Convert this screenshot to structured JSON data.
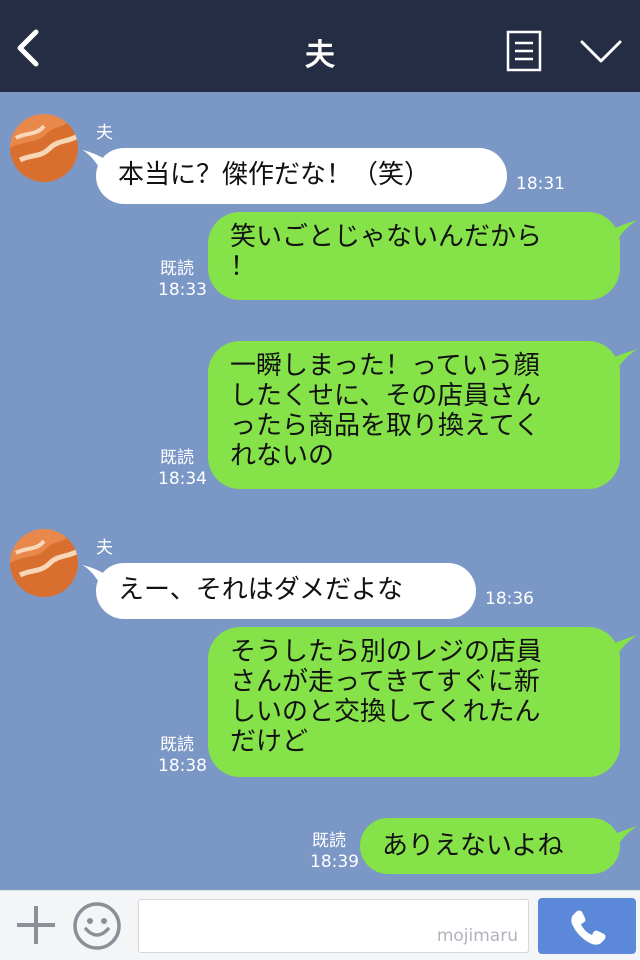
{
  "header": {
    "title": "夫",
    "back_icon": "chevron-left-icon",
    "note_icon": "note-icon",
    "menu_icon": "chevron-down-icon",
    "background": "#252d45"
  },
  "colors": {
    "chat_background": "#7b97c6",
    "outgoing_bubble": "#85e249",
    "incoming_bubble": "#ffffff",
    "send_button": "#5b88d9"
  },
  "messages": [
    {
      "direction": "in",
      "sender": "夫",
      "text": "本当に？傑作だな！（笑）",
      "time": "18:31"
    },
    {
      "direction": "out",
      "text": "笑いごとじゃないんだから\n！",
      "read": "既読",
      "time": "18:33"
    },
    {
      "direction": "out",
      "text": "一瞬しまった！っていう顔\nしたくせに、その店員さん\nったら商品を取り換えてく\nれないの",
      "read": "既読",
      "time": "18:34"
    },
    {
      "direction": "in",
      "sender": "夫",
      "text": "えー、それはダメだよな",
      "time": "18:36"
    },
    {
      "direction": "out",
      "text": "そうしたら別のレジの店員\nさんが走ってきてすぐに新\nしいのと交換してくれたん\nだけど",
      "read": "既読",
      "time": "18:38"
    },
    {
      "direction": "out",
      "text": "ありえないよね",
      "read": "既読",
      "time": "18:39"
    }
  ],
  "footer": {
    "plus_icon": "plus-icon",
    "emoji_icon": "smile-icon",
    "input_value": "",
    "watermark": "mojimaru",
    "call_icon": "phone-icon"
  }
}
